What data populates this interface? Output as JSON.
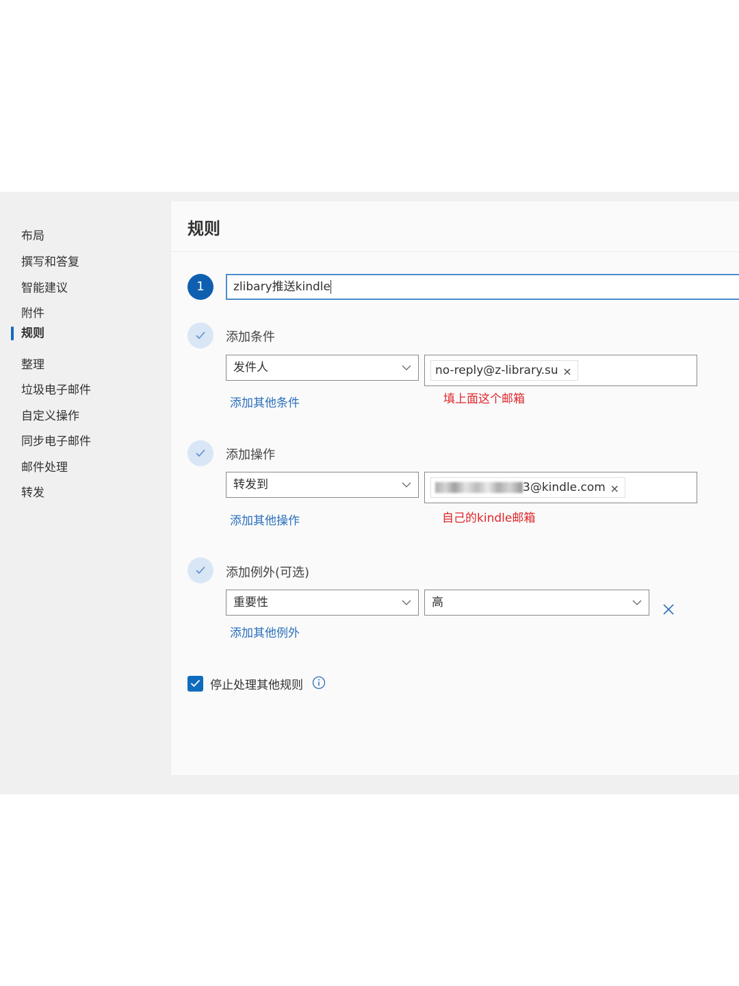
{
  "sidebar": {
    "items": [
      {
        "label": "布局"
      },
      {
        "label": "撰写和答复"
      },
      {
        "label": "智能建议"
      },
      {
        "label": "附件"
      },
      {
        "label": "规则",
        "active": true
      },
      {
        "label": "整理"
      },
      {
        "label": "垃圾电子邮件"
      },
      {
        "label": "自定义操作"
      },
      {
        "label": "同步电子邮件"
      },
      {
        "label": "邮件处理"
      },
      {
        "label": "转发"
      }
    ]
  },
  "main": {
    "title": "规则",
    "step_number": "1",
    "rule_name": "zlibary推送kindle",
    "conditions": {
      "label": "添加条件",
      "field": "发件人",
      "value_tag": "no-reply@z-library.su",
      "add_link": "添加其他条件",
      "annotation": "填上面这个邮箱"
    },
    "actions": {
      "label": "添加操作",
      "field": "转发到",
      "value_tag_suffix": "3@kindle.com",
      "add_link": "添加其他操作",
      "annotation": "自己的kindle邮箱"
    },
    "exceptions": {
      "label": "添加例外(可选)",
      "field": "重要性",
      "value": "高",
      "add_link": "添加其他例外"
    },
    "stop_processing": {
      "label": "停止处理其他规则",
      "checked": true
    }
  },
  "colors": {
    "accent": "#0f6cbd",
    "annotation_red": "#e0252a",
    "link_blue": "#2b6fbb"
  }
}
